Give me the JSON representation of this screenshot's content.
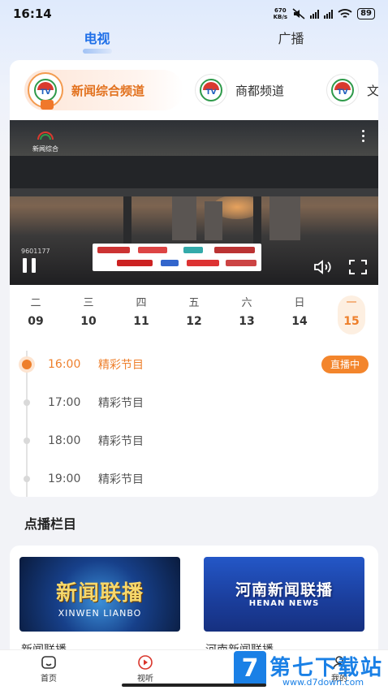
{
  "status_bar": {
    "time": "16:14",
    "net_speed_value": "670",
    "net_speed_unit": "KB/s",
    "battery": "89"
  },
  "top_tabs": [
    {
      "label": "电视",
      "active": true
    },
    {
      "label": "广播",
      "active": false
    }
  ],
  "channels": [
    {
      "label": "新闻综合频道",
      "active": true
    },
    {
      "label": "商都频道",
      "active": false
    },
    {
      "label": "文",
      "active": false
    }
  ],
  "player": {
    "channel_logo_text": "新闻综合",
    "code_text": "9601177"
  },
  "days": [
    {
      "weekday": "二",
      "date": "09",
      "active": false
    },
    {
      "weekday": "三",
      "date": "10",
      "active": false
    },
    {
      "weekday": "四",
      "date": "11",
      "active": false
    },
    {
      "weekday": "五",
      "date": "12",
      "active": false
    },
    {
      "weekday": "六",
      "date": "13",
      "active": false
    },
    {
      "weekday": "日",
      "date": "14",
      "active": false
    },
    {
      "weekday": "一",
      "date": "15",
      "active": true
    }
  ],
  "schedule": [
    {
      "time": "16:00",
      "name": "精彩节目",
      "live": true,
      "badge": "直播中"
    },
    {
      "time": "17:00",
      "name": "精彩节目",
      "live": false
    },
    {
      "time": "18:00",
      "name": "精彩节目",
      "live": false
    },
    {
      "time": "19:00",
      "name": "精彩节目",
      "live": false
    }
  ],
  "vod_section": {
    "title": "点播栏目",
    "items": [
      {
        "thumb_title": "新闻联播",
        "thumb_subtitle": "XINWEN LIANBO",
        "title": "新闻联播"
      },
      {
        "thumb_title": "河南新闻联播",
        "thumb_subtitle": "HENAN NEWS",
        "title": "河南新闻联播"
      }
    ]
  },
  "bottom_nav": [
    {
      "label": "首页",
      "icon": "home-icon",
      "active": false
    },
    {
      "label": "视听",
      "icon": "play-icon",
      "active": true
    },
    {
      "label": "我的",
      "icon": "user-icon",
      "active": false
    }
  ],
  "watermark": {
    "box": "7",
    "big": "第七下载站",
    "url": "www.d7down.com"
  },
  "colors": {
    "accent_blue": "#1e6fe8",
    "accent_orange": "#ee7f2b",
    "live_badge": "#f3852c"
  }
}
